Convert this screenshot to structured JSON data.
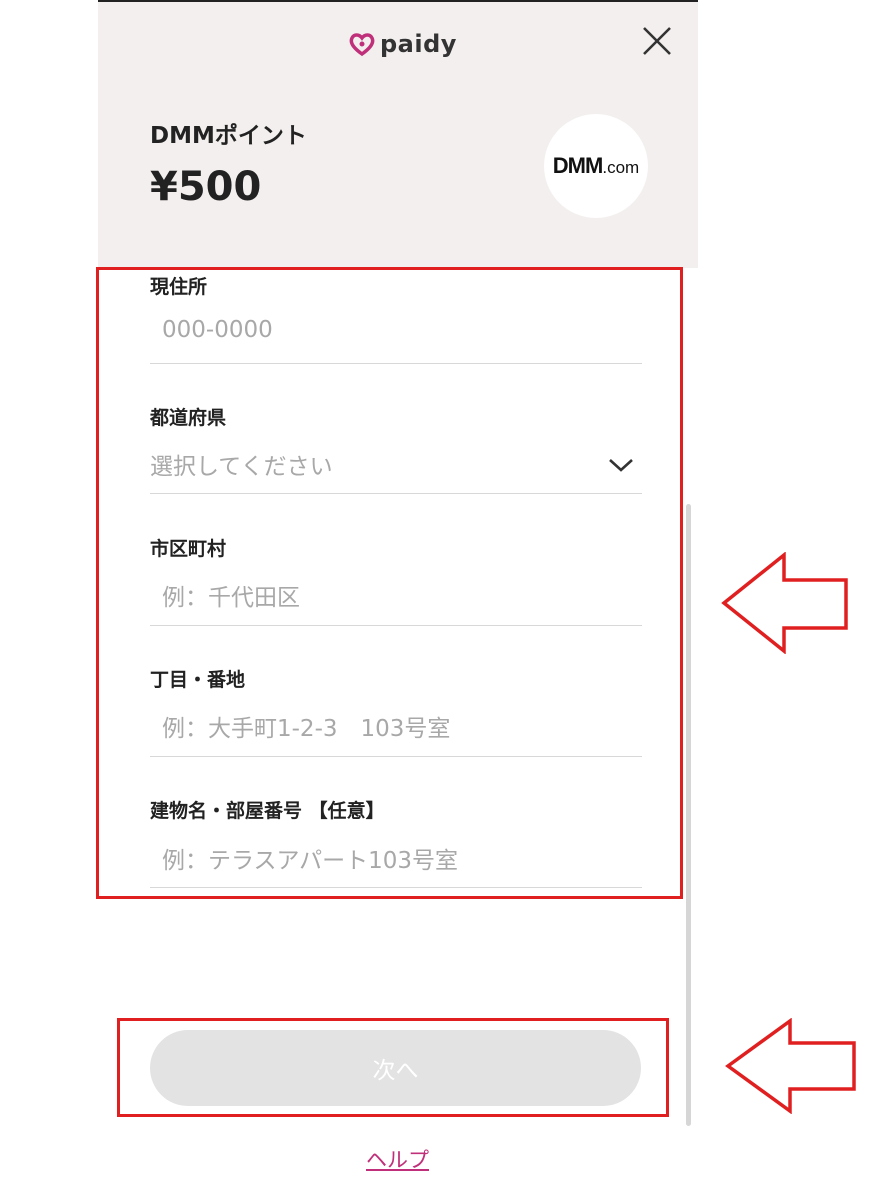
{
  "header": {
    "brand": "paidy",
    "merchant_name": "DMMポイント",
    "amount": "¥500",
    "merchant_logo_main": "DMM",
    "merchant_logo_suffix": ".com",
    "close_icon": "close-icon"
  },
  "form": {
    "zip": {
      "label": "現住所",
      "placeholder": "000-0000"
    },
    "prefecture": {
      "label": "都道府県",
      "placeholder": "選択してください",
      "icon": "chevron-down-icon"
    },
    "city": {
      "label": "市区町村",
      "placeholder": "例：千代田区"
    },
    "street": {
      "label": "丁目・番地",
      "placeholder": "例：大手町1-2-3　103号室"
    },
    "building": {
      "label": "建物名・部屋番号 【任意】",
      "placeholder": "例：テラスアパート103号室"
    }
  },
  "actions": {
    "next_label": "次へ",
    "help_label": "ヘルプ"
  },
  "colors": {
    "header_bg": "#f3efee",
    "brand": "#c0307a",
    "annotation": "#e02020",
    "button_disabled": "#e3e3e3"
  }
}
